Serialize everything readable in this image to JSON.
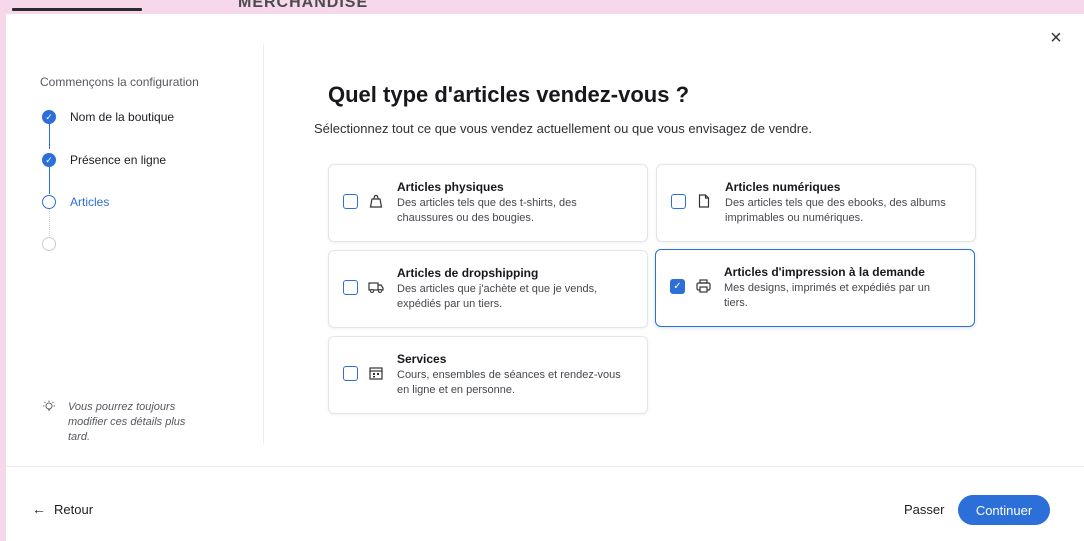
{
  "backdrop": {
    "heading": "MERCHANDISE"
  },
  "modal": {
    "close_label": "×"
  },
  "sidebar": {
    "title": "Commençons la configuration",
    "steps": [
      {
        "label": "Nom de la boutique",
        "state": "done"
      },
      {
        "label": "Présence en ligne",
        "state": "done"
      },
      {
        "label": "Articles",
        "state": "current"
      },
      {
        "label": "",
        "state": "todo"
      }
    ],
    "tip": "Vous pourrez toujours modifier ces détails plus tard."
  },
  "main": {
    "title": "Quel type d'articles vendez-vous ?",
    "subtitle": "Sélectionnez tout ce que vous vendez actuellement ou que vous envisagez de vendre.",
    "options": [
      {
        "title": "Articles physiques",
        "description": "Des articles tels que des t-shirts, des chaussures ou des bougies.",
        "icon": "bag-icon",
        "checked": false
      },
      {
        "title": "Articles numériques",
        "description": "Des articles tels que des ebooks, des albums imprimables ou numériques.",
        "icon": "file-icon",
        "checked": false
      },
      {
        "title": "Articles de dropshipping",
        "description": "Des articles que j'achète et que je vends, expédiés par un tiers.",
        "icon": "truck-icon",
        "checked": false
      },
      {
        "title": "Articles d'impression à la demande",
        "description": "Mes designs, imprimés et expédiés par un tiers.",
        "icon": "printer-icon",
        "checked": true
      },
      {
        "title": "Services",
        "description": "Cours, ensembles de séances et rendez-vous en ligne et en personne.",
        "icon": "calendar-icon",
        "checked": false
      }
    ]
  },
  "footer": {
    "back_label": "Retour",
    "skip_label": "Passer",
    "continue_label": "Continuer"
  },
  "colors": {
    "accent": "#2c6fd8",
    "backdrop": "#f7d8ea"
  }
}
